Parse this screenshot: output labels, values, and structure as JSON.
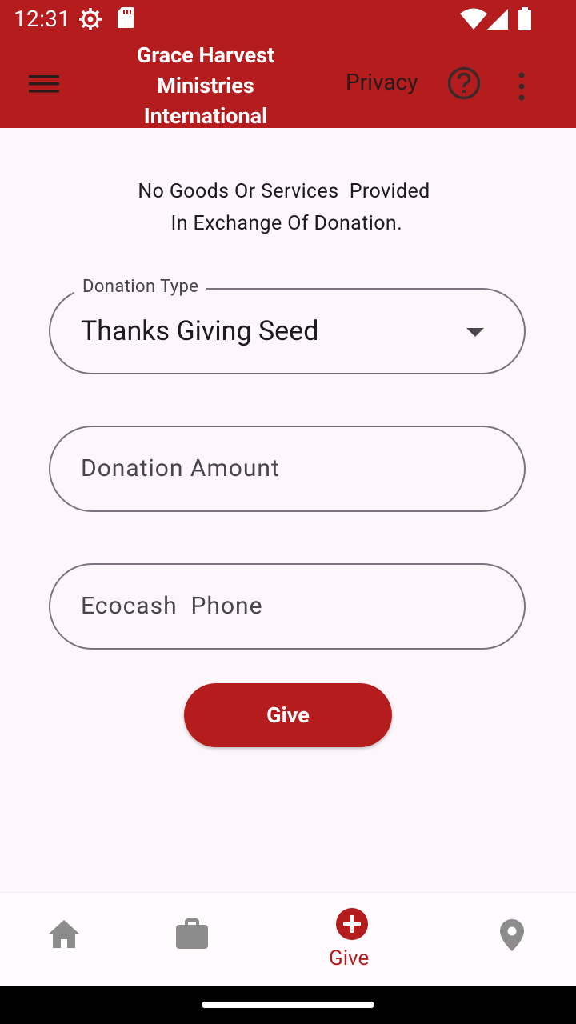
{
  "status": {
    "time": "12:31",
    "icons": [
      "settings-gear-icon",
      "sd-card-icon",
      "wifi-icon",
      "cell-signal-icon",
      "battery-icon"
    ]
  },
  "appbar": {
    "title_lines": [
      "Grace Harvest",
      "Ministries",
      "International"
    ],
    "privacy_label": "Privacy",
    "icons": [
      "hamburger-menu-icon",
      "help-circle-icon",
      "more-vert-icon"
    ],
    "background": "#b41c1e"
  },
  "main": {
    "notice_lines": [
      "No Goods Or Services  Provided",
      " In Exchange Of Donation."
    ],
    "donation_type": {
      "label": "Donation Type",
      "value": "Thanks Giving Seed"
    },
    "donation_amount": {
      "placeholder": "Donation Amount",
      "value": ""
    },
    "ecocash_phone": {
      "placeholder": "Ecocash  Phone",
      "value": ""
    },
    "give_button_label": "Give"
  },
  "bottom_nav": {
    "items": [
      {
        "icon": "home-icon",
        "label": "",
        "active": false
      },
      {
        "icon": "briefcase-icon",
        "label": "",
        "active": false
      },
      {
        "icon": "add-circle-icon",
        "label": "Give",
        "active": true
      },
      {
        "icon": "location-pin-icon",
        "label": "",
        "active": false
      }
    ],
    "active_color": "#b41c1e"
  }
}
